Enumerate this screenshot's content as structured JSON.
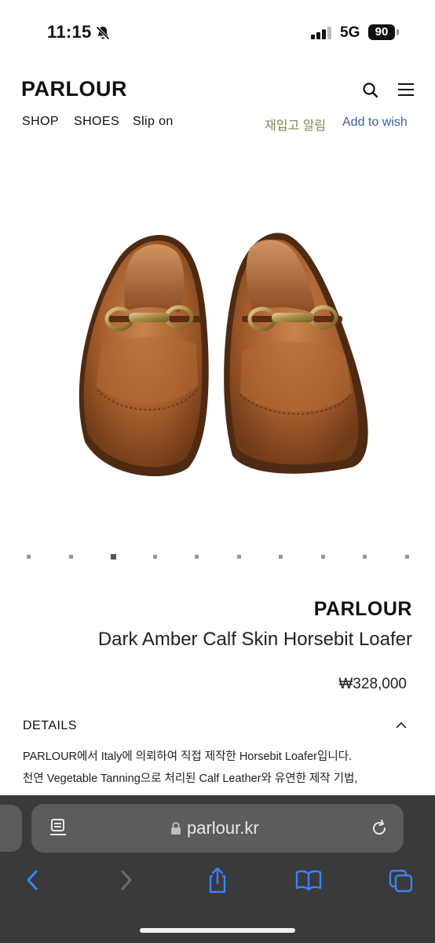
{
  "status_bar": {
    "time": "11:15",
    "network": "5G",
    "battery": "90"
  },
  "header": {
    "brand": "PARLOUR",
    "nav": [
      "SHOP",
      "SHOES",
      "Slip on"
    ],
    "restock_label": "재입고 알림",
    "wish_label": "Add to wish"
  },
  "gallery": {
    "slide_count": 10,
    "active_index": 2
  },
  "product": {
    "brand": "PARLOUR",
    "name": "Dark Amber Calf Skin Horsebit Loafer",
    "price": "₩328,000",
    "details_label": "DETAILS",
    "description": [
      "PARLOUR에서 Italy에 의뢰하여 직접 제작한 Horsebit Loafer입니다.",
      "천연 Vegetable Tanning으로 처리된 Calf Leather와 유연한 제작 기법,"
    ]
  },
  "browser": {
    "url": "parlour.kr"
  },
  "colors": {
    "restock": "#7c8a55",
    "wish": "#3b5fa8",
    "toolbar_bg": "#3a3a3c",
    "toolbar_icons": "#3a82f7"
  }
}
